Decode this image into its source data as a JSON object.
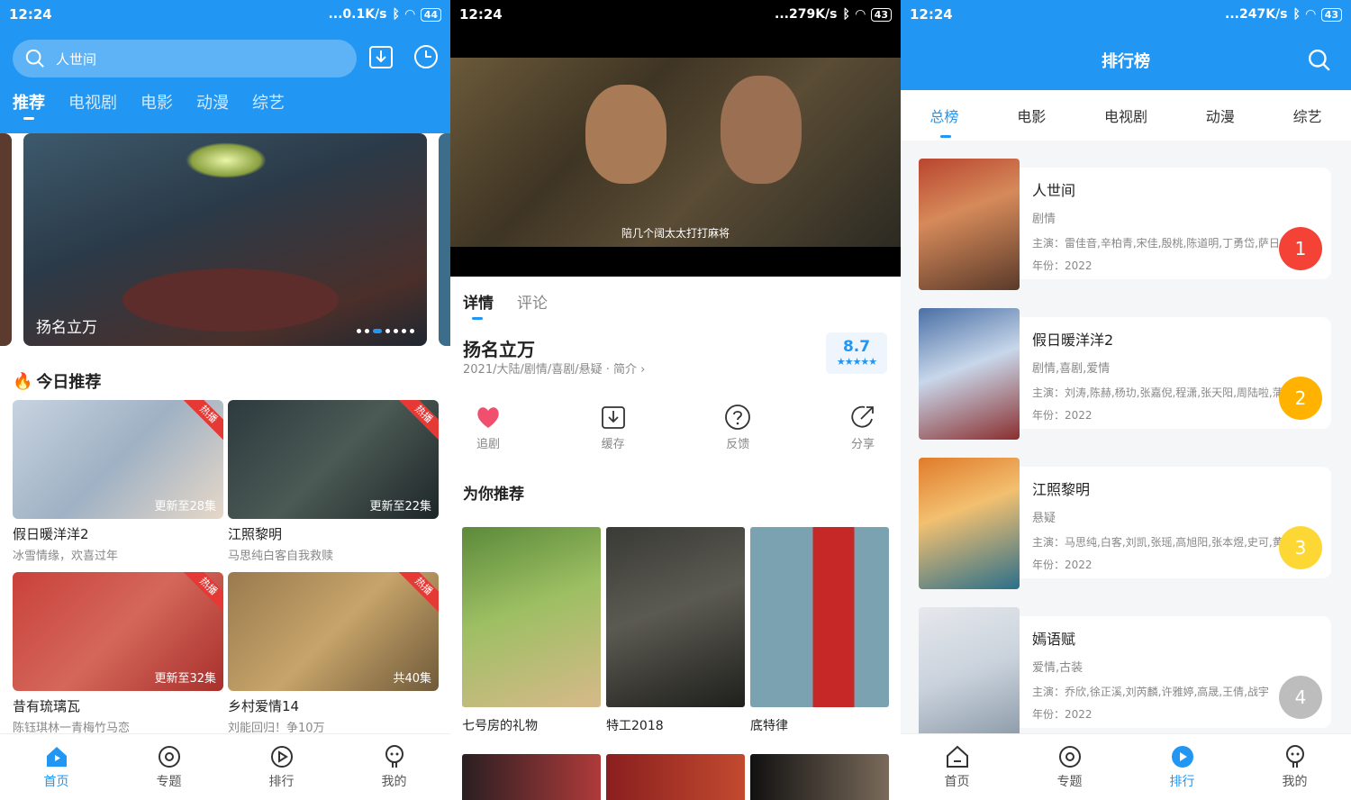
{
  "colors": {
    "brand": "#2196f3",
    "hot": "#e53935",
    "rank1": "#f44336",
    "rank2": "#ffb300",
    "rank3": "#fdd835",
    "rank4": "#bdbdbd"
  },
  "panel1": {
    "status": {
      "time": "12:24",
      "speed": "...0.1K/s",
      "battery": "44"
    },
    "search": {
      "value": "人世间"
    },
    "tabs": [
      "推荐",
      "电视剧",
      "电影",
      "动漫",
      "综艺"
    ],
    "banner": {
      "title": "扬名立万"
    },
    "section_title": "今日推荐",
    "cards": [
      {
        "title": "假日暖洋洋2",
        "sub": "冰雪情缘，欢喜过年",
        "ep": "更新至28集",
        "hot": "热播"
      },
      {
        "title": "江照黎明",
        "sub": "马思纯白客自我救赎",
        "ep": "更新至22集",
        "hot": "热播"
      },
      {
        "title": "昔有琉璃瓦",
        "sub": "陈钰琪林一青梅竹马恋",
        "ep": "更新至32集",
        "hot": "热播"
      },
      {
        "title": "乡村爱情14",
        "sub": "刘能回归！争10万",
        "ep": "共40集",
        "hot": "热播"
      }
    ],
    "nav": [
      "首页",
      "专题",
      "排行",
      "我的"
    ]
  },
  "panel2": {
    "status": {
      "time": "12:24",
      "speed": "...279K/s",
      "battery": "43"
    },
    "subtitle": "陪几个阔太太打打麻将",
    "tabs": [
      "详情",
      "评论"
    ],
    "title": "扬名立万",
    "meta": "2021/大陆/剧情/喜剧/悬疑 · 简介",
    "score": "8.7",
    "stars": "★★★★★",
    "actions": [
      "追剧",
      "缓存",
      "反馈",
      "分享"
    ],
    "rec_title": "为你推荐",
    "recs": [
      "七号房的礼物",
      "特工2018",
      "底特律"
    ]
  },
  "panel3": {
    "status": {
      "time": "12:24",
      "speed": "...247K/s",
      "battery": "43"
    },
    "title": "排行榜",
    "tabs": [
      "总榜",
      "电影",
      "电视剧",
      "动漫",
      "综艺"
    ],
    "ranks": [
      {
        "name": "人世间",
        "genre": "剧情",
        "cast": "主演：雷佳音,辛柏青,宋佳,殷桃,陈道明,丁勇岱,萨日娜...",
        "year": "年份：2022",
        "no": "1"
      },
      {
        "name": "假日暖洋洋2",
        "genre": "剧情,喜剧,爱情",
        "cast": "主演：刘涛,陈赫,杨玏,张嘉倪,程潇,张天阳,周陆啦,蒲奕...",
        "year": "年份：2022",
        "no": "2"
      },
      {
        "name": "江照黎明",
        "genre": "悬疑",
        "cast": "主演：马思纯,白客,刘凯,张瑶,高旭阳,张本煜,史可,黄澄...",
        "year": "年份：2022",
        "no": "3"
      },
      {
        "name": "嫣语赋",
        "genre": "爱情,古装",
        "cast": "主演：乔欣,徐正溪,刘芮麟,许雅婷,高晟,王倩,战宇",
        "year": "年份：2022",
        "no": "4"
      }
    ],
    "nav": [
      "首页",
      "专题",
      "排行",
      "我的"
    ]
  }
}
